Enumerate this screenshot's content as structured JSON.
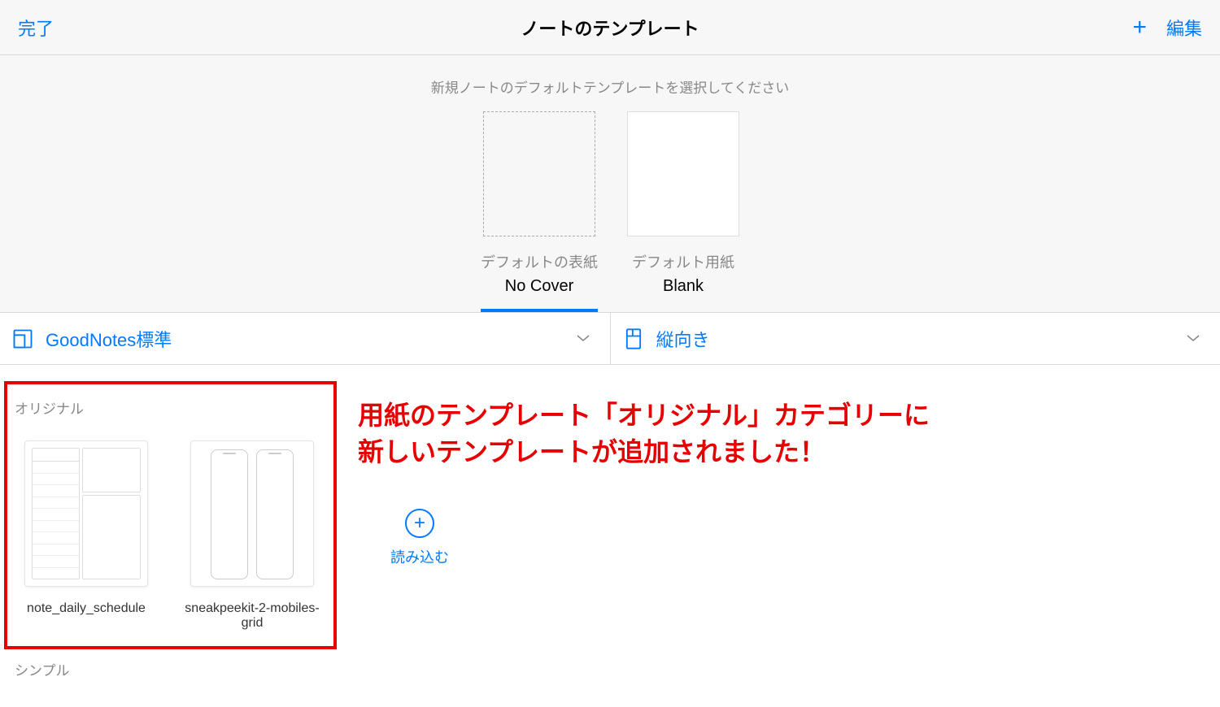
{
  "header": {
    "done_label": "完了",
    "title": "ノートのテンプレート",
    "edit_label": "編集"
  },
  "defaults": {
    "instruction": "新規ノートのデフォルトテンプレートを選択してください",
    "cover": {
      "label": "デフォルトの表紙",
      "value": "No Cover"
    },
    "paper": {
      "label": "デフォルト用紙",
      "value": "Blank"
    }
  },
  "selectors": {
    "size": "GoodNotes標準",
    "orientation": "縦向き"
  },
  "categories": {
    "original": {
      "label": "オリジナル",
      "templates": [
        {
          "name": "note_daily_schedule"
        },
        {
          "name": "sneakpeekit-2-mobiles-grid"
        }
      ]
    },
    "simple": {
      "label": "シンプル"
    }
  },
  "import": {
    "label": "読み込む"
  },
  "annotation": {
    "line1": "用紙のテンプレート「オリジナル」カテゴリーに",
    "line2": "新しいテンプレートが追加されました！"
  }
}
